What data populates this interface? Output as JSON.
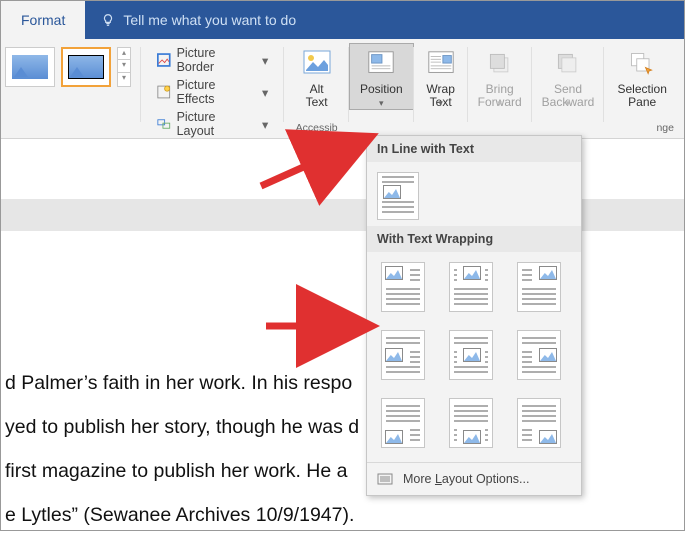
{
  "tabs": {
    "format": "Format"
  },
  "tellme": {
    "placeholder": "Tell me what you want to do"
  },
  "ribbon": {
    "pic_border": "Picture Border",
    "pic_effects": "Picture Effects",
    "pic_layout": "Picture Layout",
    "alt_text": "Alt\nText",
    "position": "Position",
    "wrap_text": "Wrap\nText",
    "bring_forward": "Bring\nForward",
    "send_backward": "Send\nBackward",
    "selection_pane": "Selection\nPane",
    "group_accessibility": "Accessib",
    "group_arrange": "nge"
  },
  "dropdown": {
    "head_inline": "In Line with Text",
    "head_wrap": "With Text Wrapping",
    "more_layout": "More Layout Options..."
  },
  "document": {
    "l1": "d Palmer’s faith in her work. In his respo",
    "l2": "yed to publish her story, though he was d",
    "l3": "first magazine to publish her work. He a",
    "l4": "e Lytles” (Sewanee Archives 10/9/1947)."
  }
}
